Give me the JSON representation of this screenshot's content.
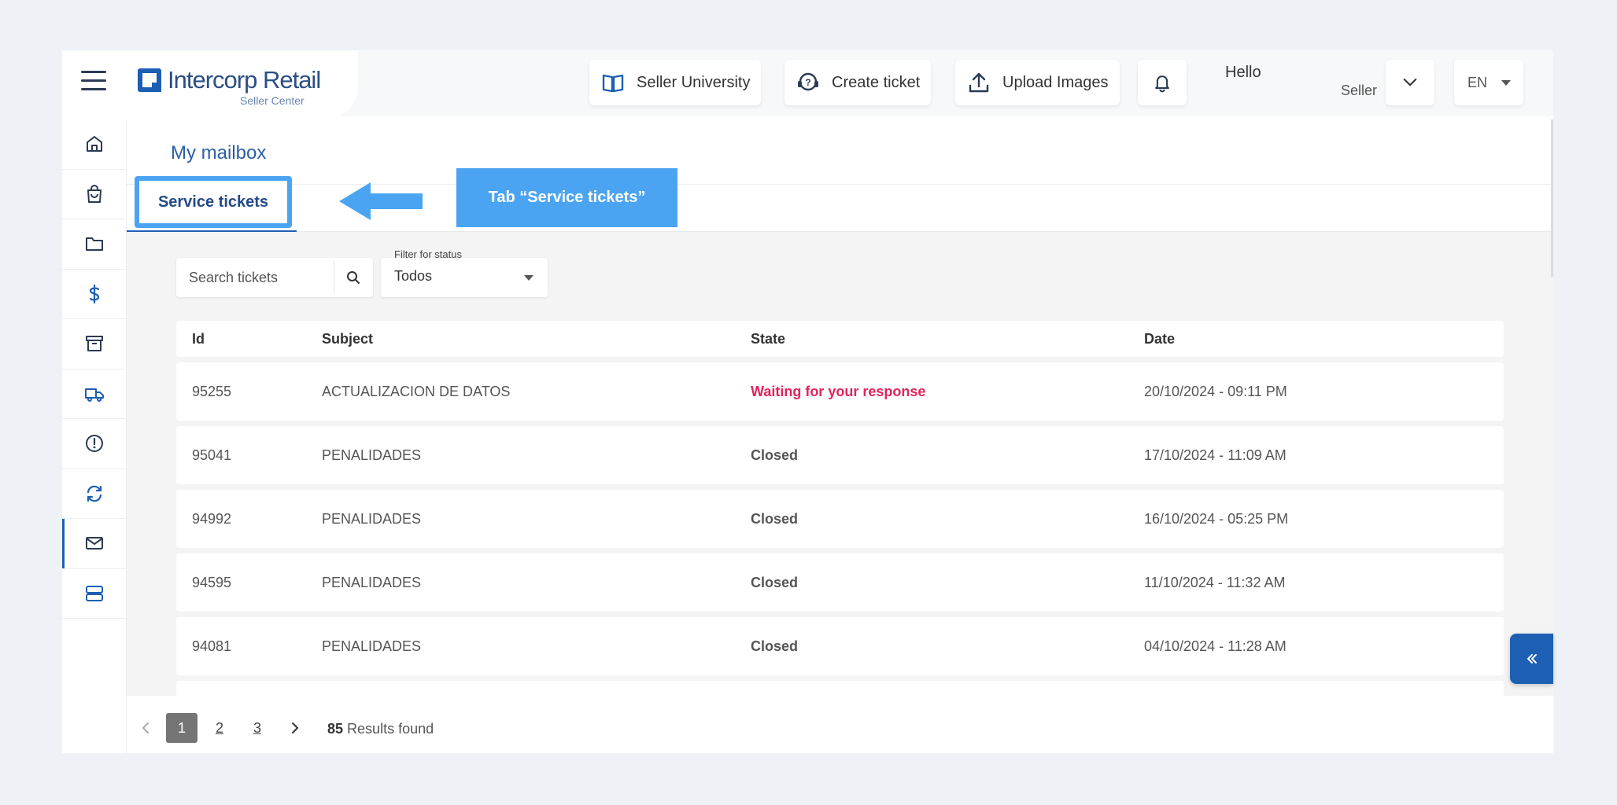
{
  "brand": {
    "name": "Intercorp Retail",
    "sub": "Seller Center",
    "color": "#1d5fb3"
  },
  "header": {
    "seller_university": "Seller University",
    "create_ticket": "Create ticket",
    "upload_images": "Upload Images",
    "greeting": "Hello",
    "user_role": "Seller",
    "language": "EN"
  },
  "sidebar": {
    "items": [
      {
        "icon": "home-icon"
      },
      {
        "icon": "shopping-bag-icon"
      },
      {
        "icon": "folder-icon"
      },
      {
        "icon": "dollar-icon"
      },
      {
        "icon": "archive-icon"
      },
      {
        "icon": "truck-icon"
      },
      {
        "icon": "alert-icon"
      },
      {
        "icon": "refresh-icon"
      },
      {
        "icon": "mail-icon",
        "active": true
      },
      {
        "icon": "server-icon"
      }
    ]
  },
  "mailbox": {
    "title": "My mailbox",
    "tab_service": "Service tickets",
    "callout": "Tab “Service tickets”"
  },
  "filters": {
    "search_placeholder": "Search tickets",
    "status_label": "Filter for status",
    "status_value": "Todos"
  },
  "table": {
    "headers": {
      "id": "Id",
      "subject": "Subject",
      "state": "State",
      "date": "Date"
    },
    "rows": [
      {
        "id": "95255",
        "subject": "ACTUALIZACION DE DATOS",
        "state": "Waiting for your response",
        "date": "20/10/2024 - 09:11 PM"
      },
      {
        "id": "95041",
        "subject": "PENALIDADES",
        "state": "Closed",
        "date": "17/10/2024 - 11:09 AM"
      },
      {
        "id": "94992",
        "subject": "PENALIDADES",
        "state": "Closed",
        "date": "16/10/2024 - 05:25 PM"
      },
      {
        "id": "94595",
        "subject": "PENALIDADES",
        "state": "Closed",
        "date": "11/10/2024 - 11:32 AM"
      },
      {
        "id": "94081",
        "subject": "PENALIDADES",
        "state": "Closed",
        "date": "04/10/2024 - 11:28 AM"
      }
    ]
  },
  "pagination": {
    "pages": [
      "1",
      "2",
      "3"
    ],
    "current": "1",
    "results_count": "85",
    "results_label": "Results found"
  },
  "colors": {
    "accent": "#4aa4f2",
    "waiting": "#e0245e",
    "primary": "#1d5fb3"
  }
}
